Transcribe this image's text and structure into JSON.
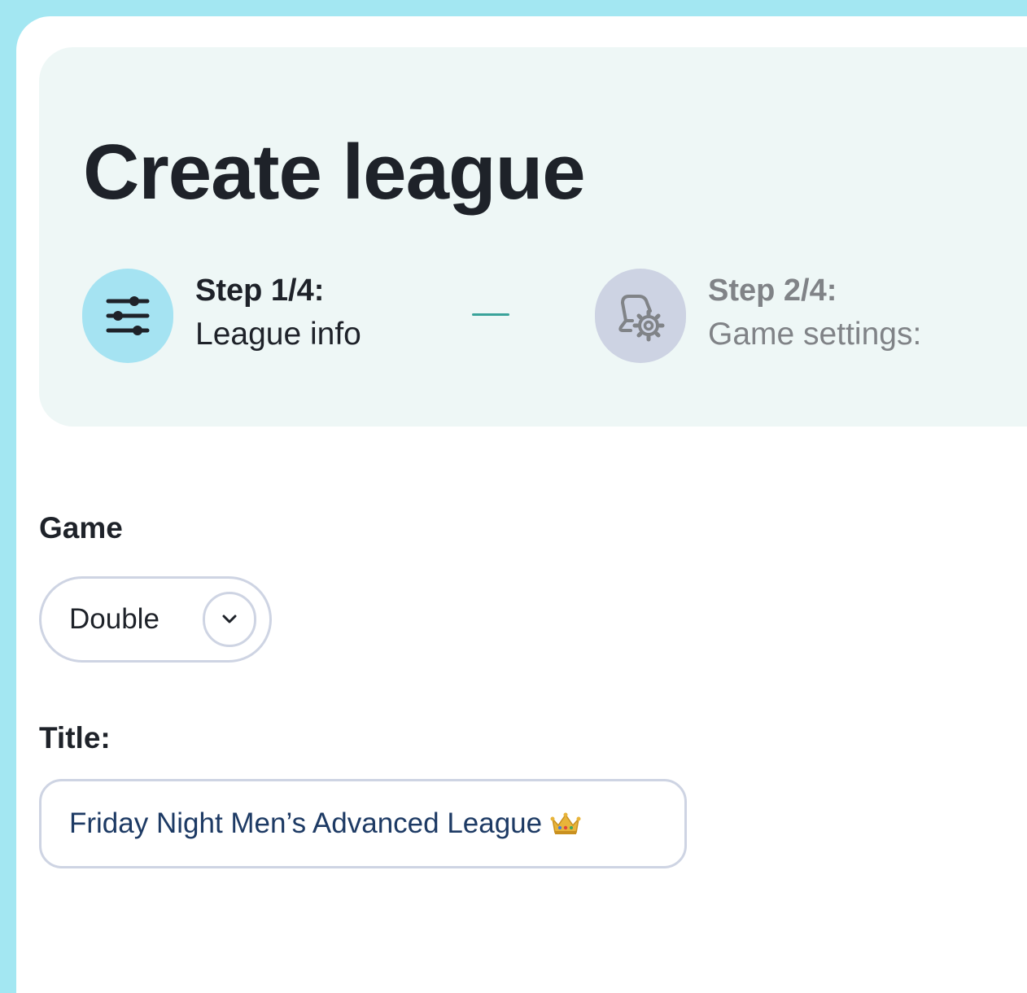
{
  "page": {
    "title": "Create league"
  },
  "steps": [
    {
      "number": "Step 1/4:",
      "label": "League info",
      "icon": "sliders-icon",
      "state": "active"
    },
    {
      "number": "Step 2/4:",
      "label": "Game settings:",
      "icon": "game-settings-icon",
      "state": "inactive"
    }
  ],
  "form": {
    "game": {
      "label": "Game",
      "value": "Double"
    },
    "title": {
      "label": "Title:",
      "value": "Friday Night Men’s Advanced League"
    }
  },
  "colors": {
    "outer_background": "#a3e7f2",
    "header_background": "#eef7f6",
    "active_step_circle": "#a5e3f2",
    "inactive_step_circle": "#cdd3e3",
    "connector": "#3aa39a",
    "input_border": "#ced4e3",
    "input_text": "#1d3a64"
  }
}
